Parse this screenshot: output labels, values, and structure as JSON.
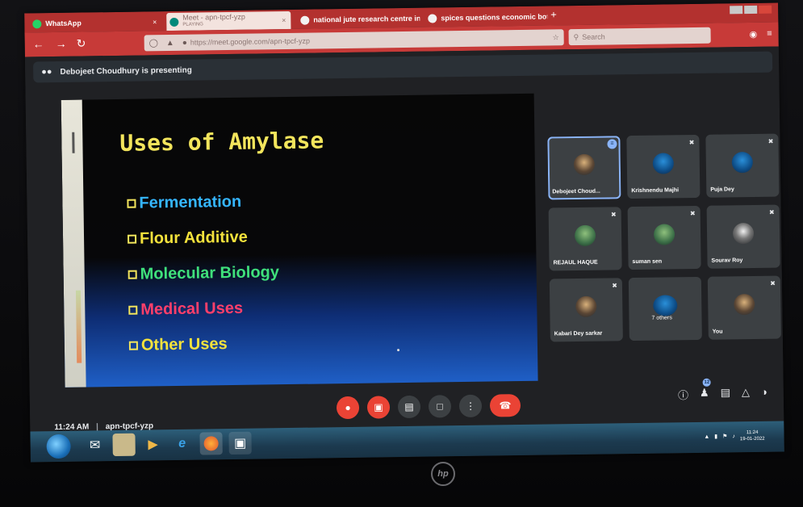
{
  "browser": {
    "tabs": [
      {
        "label": "WhatsApp",
        "close": "×"
      },
      {
        "label": "Meet - apn-tpcf-yzp",
        "sublabel": "PLAYING",
        "close": "×"
      },
      {
        "label": "national jute research centre in",
        "close": "×"
      },
      {
        "label": "spices questions economic bot",
        "close": "×"
      }
    ],
    "new_tab": "+",
    "url": "https://meet.google.com/apn-tpcf-yzp",
    "search_placeholder": "Search"
  },
  "meet": {
    "presenting_text": "Debojeet Choudhury is presenting",
    "slide": {
      "title": "Uses of Amylase",
      "bullets": [
        {
          "text": "Fermentation",
          "color": "#35b6ff"
        },
        {
          "text": "Flour Additive",
          "color": "#f4e23c"
        },
        {
          "text": "Molecular Biology",
          "color": "#3fe07b"
        },
        {
          "text": "Medical Uses",
          "color": "#ff3f6a"
        },
        {
          "text": "Other Uses",
          "color": "#f4e23c"
        }
      ]
    },
    "participants": [
      {
        "name": "Debojeet Choud...",
        "speaking": true
      },
      {
        "name": "Krishnendu Majhi",
        "muted": true
      },
      {
        "name": "Puja Dey",
        "muted": true
      },
      {
        "name": "REJAUL HAQUE",
        "muted": true
      },
      {
        "name": "suman sen",
        "muted": true
      },
      {
        "name": "Sourav Roy",
        "muted": true
      },
      {
        "name": "Kabari Dey sarkar",
        "muted": true
      },
      {
        "name": "7 others"
      },
      {
        "name": "You",
        "muted": true
      }
    ],
    "participant_count": "12",
    "time": "11:24 AM",
    "separator": "|",
    "meeting_code": "apn-tpcf-yzp"
  },
  "taskbar": {
    "clock_time": "11:24",
    "clock_date": "19-01-2022"
  },
  "brand_logo": "hp",
  "colors": {
    "browser_red": "#c73a38",
    "meet_bg": "#202124",
    "end_call": "#ea4335",
    "accent_blue": "#8ab4f8"
  }
}
